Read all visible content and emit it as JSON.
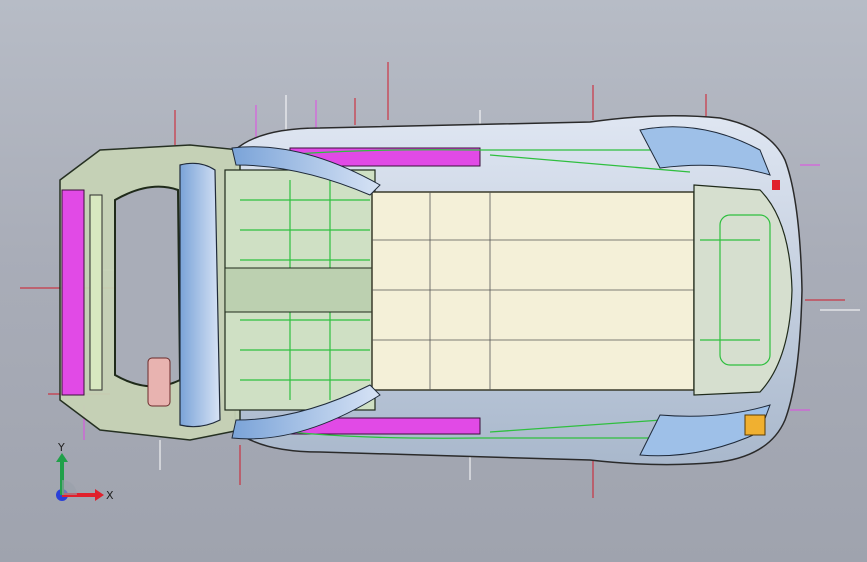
{
  "axes": {
    "x_label": "X",
    "y_label": "Y",
    "x_color": "#e0202c",
    "y_color": "#21a04a",
    "z_color": "#2a3fd8"
  },
  "colors": {
    "background": "#a9adb8",
    "floor_panel": "#f4f0d8",
    "structure_outline": "#1f2a1a",
    "green_edges": "#2fbf3f",
    "magenta_parts": "#e14ae6",
    "glass_blue": "#8fb6e6",
    "datum_lines": "#d01a2a"
  },
  "model": {
    "type": "car-body-in-white",
    "view": "top"
  }
}
